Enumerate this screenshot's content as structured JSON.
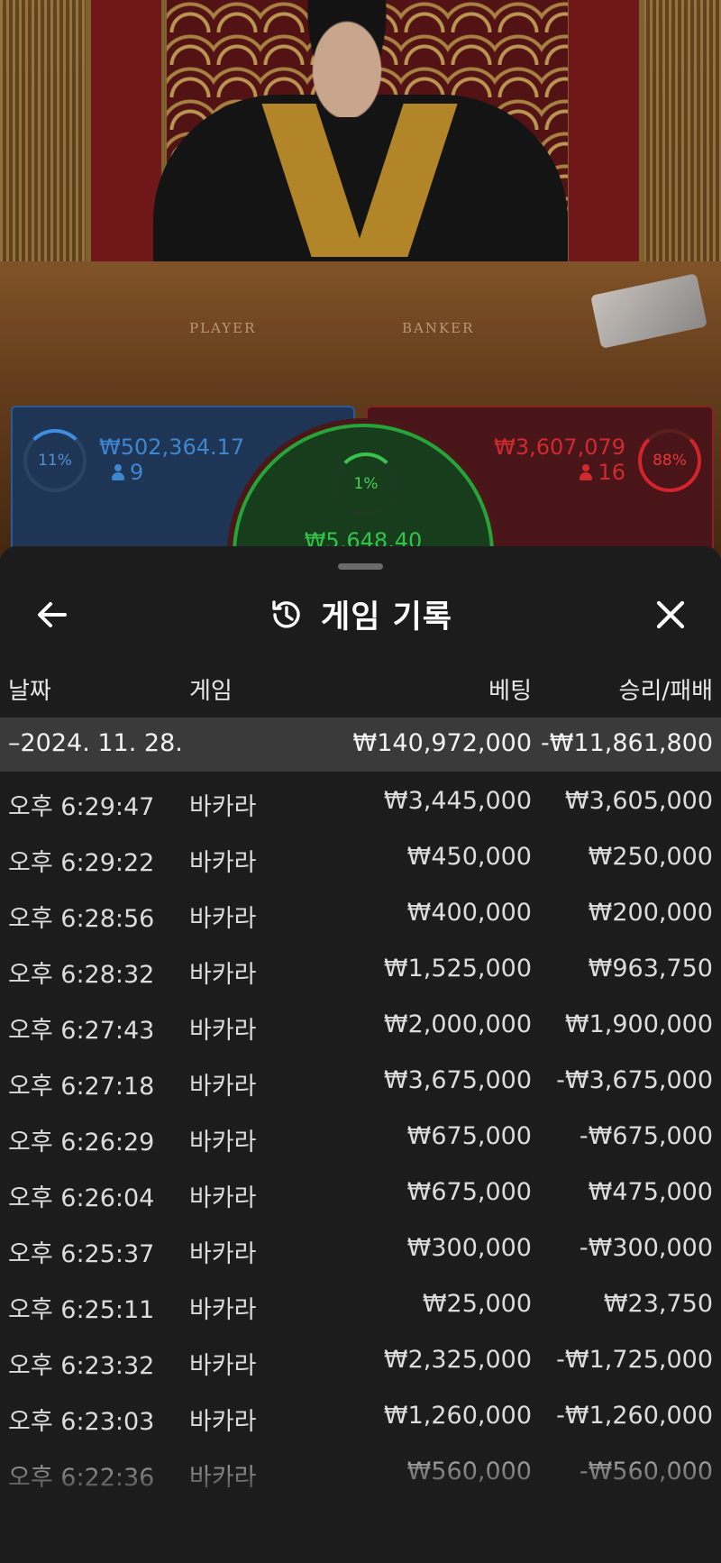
{
  "video": {
    "felt_player_label": "PLAYER",
    "felt_banker_label": "BANKER"
  },
  "bets": {
    "player": {
      "percent": "11%",
      "amount": "₩502,364.17",
      "count": "9",
      "color": "#3e86cf"
    },
    "tie": {
      "percent": "1%",
      "amount": "₩5,648.40",
      "color": "#33c24a"
    },
    "banker": {
      "percent": "88%",
      "amount": "₩3,607,079",
      "count": "16",
      "color": "#cf2a2e"
    }
  },
  "sheet": {
    "title": "게임 기록",
    "icons": {
      "back": "arrow-left-icon",
      "history": "history-icon",
      "close": "close-icon"
    },
    "columns": {
      "date": "날짜",
      "game": "게임",
      "bet": "베팅",
      "result": "승리/패배"
    },
    "date_group": {
      "date": "–2024. 11. 28.",
      "bet": "₩140,972,000",
      "result": "-₩11,861,800"
    },
    "rows": [
      {
        "time": "오후 6:29:47",
        "game": "바카라",
        "bet": "₩3,445,000",
        "result": "₩3,605,000"
      },
      {
        "time": "오후 6:29:22",
        "game": "바카라",
        "bet": "₩450,000",
        "result": "₩250,000"
      },
      {
        "time": "오후 6:28:56",
        "game": "바카라",
        "bet": "₩400,000",
        "result": "₩200,000"
      },
      {
        "time": "오후 6:28:32",
        "game": "바카라",
        "bet": "₩1,525,000",
        "result": "₩963,750"
      },
      {
        "time": "오후 6:27:43",
        "game": "바카라",
        "bet": "₩2,000,000",
        "result": "₩1,900,000"
      },
      {
        "time": "오후 6:27:18",
        "game": "바카라",
        "bet": "₩3,675,000",
        "result": "-₩3,675,000"
      },
      {
        "time": "오후 6:26:29",
        "game": "바카라",
        "bet": "₩675,000",
        "result": "-₩675,000"
      },
      {
        "time": "오후 6:26:04",
        "game": "바카라",
        "bet": "₩675,000",
        "result": "₩475,000"
      },
      {
        "time": "오후 6:25:37",
        "game": "바카라",
        "bet": "₩300,000",
        "result": "-₩300,000"
      },
      {
        "time": "오후 6:25:11",
        "game": "바카라",
        "bet": "₩25,000",
        "result": "₩23,750"
      },
      {
        "time": "오후 6:23:32",
        "game": "바카라",
        "bet": "₩2,325,000",
        "result": "-₩1,725,000"
      },
      {
        "time": "오후 6:23:03",
        "game": "바카라",
        "bet": "₩1,260,000",
        "result": "-₩1,260,000"
      },
      {
        "time": "오후 6:22:36",
        "game": "바카라",
        "bet": "₩560,000",
        "result": "-₩560,000"
      }
    ]
  }
}
